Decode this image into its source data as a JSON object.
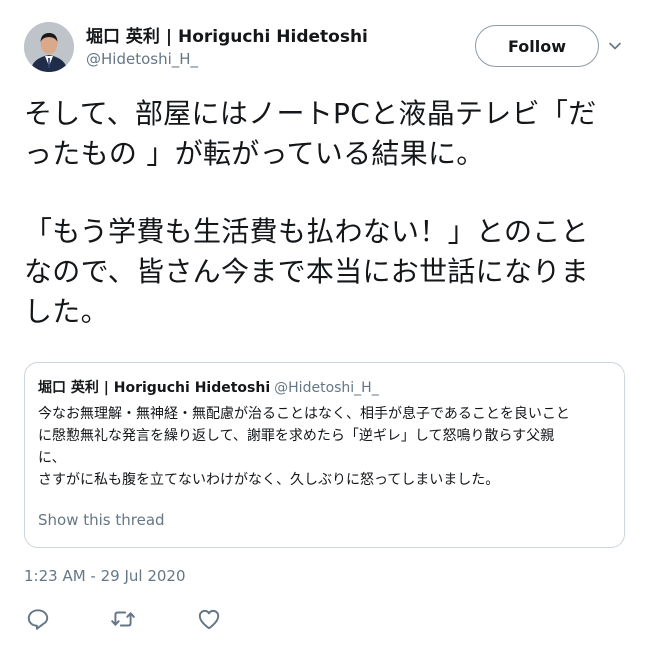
{
  "author": {
    "name": "堀口 英利 | Horiguchi Hidetoshi",
    "handle": "@Hidetoshi_H_",
    "avatar_icon": "profile-photo"
  },
  "follow_button": {
    "label": "Follow"
  },
  "menu": {
    "icon": "chevron-down-icon"
  },
  "tweet": {
    "lines": [
      "そして、部屋にはノートPCと液晶テレビ「だ",
      "ったもの 」が転がっている結果に。",
      "「もう学費も生活費も払わない！」とのこと",
      "なので、皆さん今まで本当にお世話になりま",
      "した。"
    ]
  },
  "quote": {
    "name": "堀口 英利 | Horiguchi Hidetoshi",
    "handle": "@Hidetoshi_H_",
    "lines": [
      "今なお無理解・無神経・無配慮が治ることはなく、相手が息子であることを良いこと",
      "に慇懃無礼な発言を繰り返して、謝罪を求めたら「逆ギレ」して怒鳴り散らす父親",
      "に、",
      "さすがに私も腹を立てないわけがなく、久しぶりに怒ってしまいました。"
    ],
    "show_thread": "Show this thread"
  },
  "timestamp": "1:23 AM - 29 Jul 2020",
  "actions": {
    "reply_icon": "reply-icon",
    "retweet_icon": "retweet-icon",
    "like_icon": "heart-icon"
  },
  "colors": {
    "text": "#14171a",
    "secondary": "#657786",
    "border": "#ccd6dd"
  }
}
